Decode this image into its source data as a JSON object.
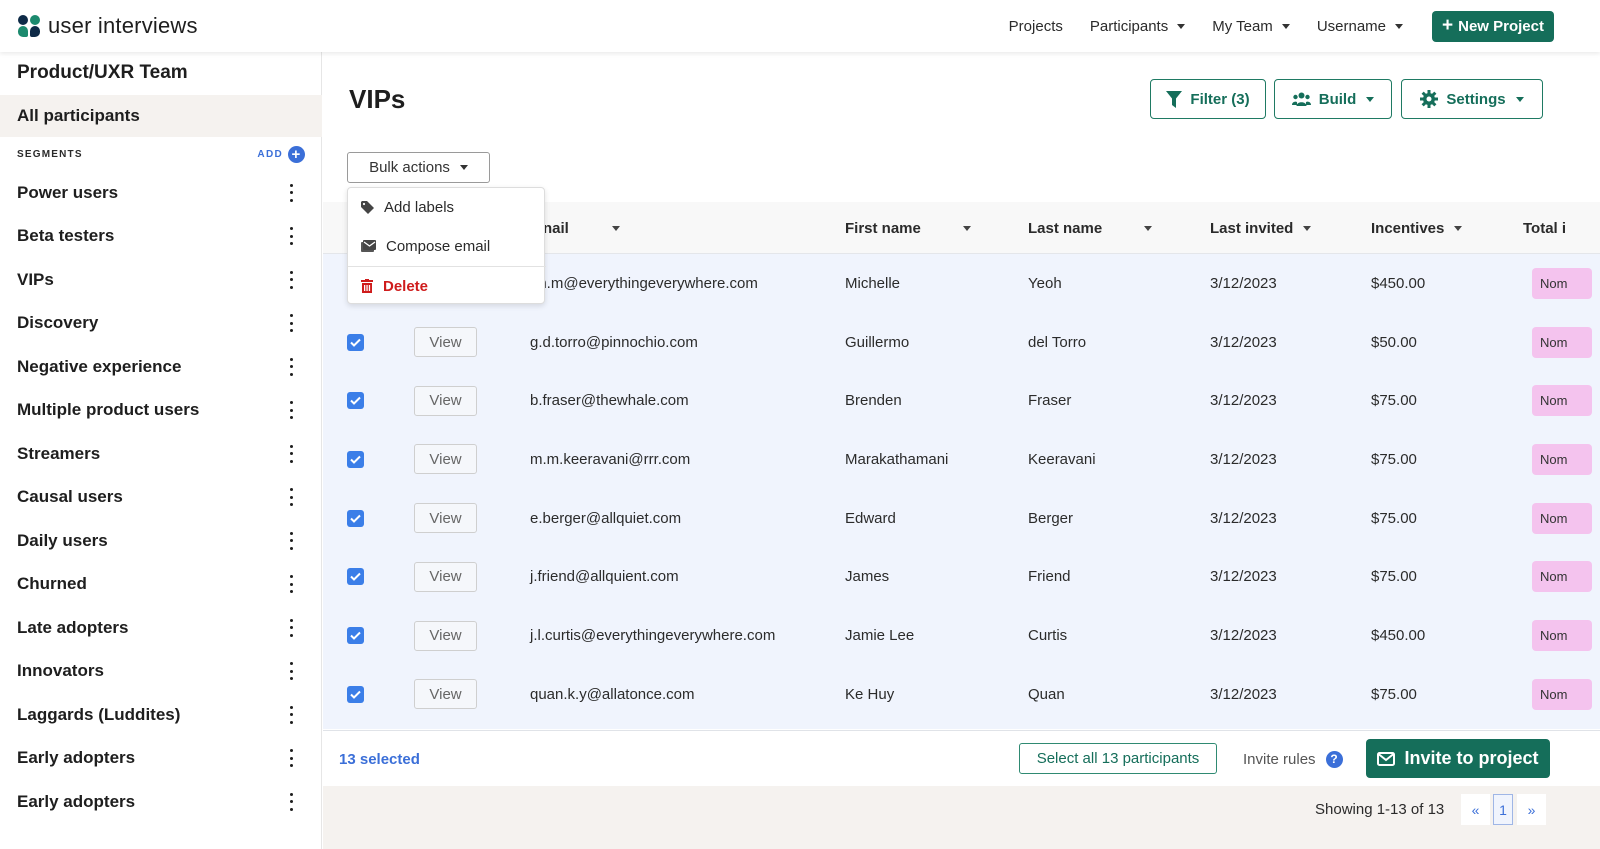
{
  "app": {
    "logo_text": "user interviews"
  },
  "topnav": {
    "items": [
      {
        "label": "Projects",
        "has_caret": false
      },
      {
        "label": "Participants",
        "has_caret": true
      },
      {
        "label": "My Team",
        "has_caret": true
      },
      {
        "label": "Username",
        "has_caret": true
      }
    ],
    "new_project_label": "New Project"
  },
  "sidebar": {
    "team_title": "Product/UXR Team",
    "all_participants_label": "All participants",
    "segments_label": "SEGMENTS",
    "add_label": "ADD",
    "segments": [
      "Power users",
      "Beta testers",
      "VIPs",
      "Discovery",
      "Negative experience",
      "Multiple product users",
      "Streamers",
      "Causal users",
      "Daily users",
      "Churned",
      "Late adopters",
      "Innovators",
      "Laggards (Luddites)",
      "Early adopters",
      "Early adopters"
    ]
  },
  "main": {
    "page_title": "VIPs",
    "toolbar": {
      "filter_label": "Filter (3)",
      "build_label": "Build",
      "settings_label": "Settings"
    },
    "bulk_actions_label": "Bulk actions",
    "bulk_menu": {
      "add_labels": "Add labels",
      "compose_email": "Compose email",
      "delete": "Delete"
    },
    "table": {
      "columns": [
        "nail",
        "First name",
        "Last name",
        "Last invited",
        "Incentives",
        "Total i"
      ],
      "view_label": "View",
      "rows": [
        {
          "email": "oh.m@everythingeverywhere.com",
          "first": "Michelle",
          "last": "Yeoh",
          "invited": "3/12/2023",
          "incentive": "$450.00",
          "tag": "Nom",
          "checked": true
        },
        {
          "email": "g.d.torro@pinnochio.com",
          "first": "Guillermo",
          "last": "del Torro",
          "invited": "3/12/2023",
          "incentive": "$50.00",
          "tag": "Nom",
          "checked": true
        },
        {
          "email": "b.fraser@thewhale.com",
          "first": "Brenden",
          "last": "Fraser",
          "invited": "3/12/2023",
          "incentive": "$75.00",
          "tag": "Nom",
          "checked": true
        },
        {
          "email": "m.m.keeravani@rrr.com",
          "first": "Marakathamani",
          "last": "Keeravani",
          "invited": "3/12/2023",
          "incentive": "$75.00",
          "tag": "Nom",
          "checked": true
        },
        {
          "email": "e.berger@allquiet.com",
          "first": "Edward",
          "last": "Berger",
          "invited": "3/12/2023",
          "incentive": "$75.00",
          "tag": "Nom",
          "checked": true
        },
        {
          "email": "j.friend@allquient.com",
          "first": "James",
          "last": "Friend",
          "invited": "3/12/2023",
          "incentive": "$75.00",
          "tag": "Nom",
          "checked": true
        },
        {
          "email": "j.l.curtis@everythingeverywhere.com",
          "first": "Jamie Lee",
          "last": "Curtis",
          "invited": "3/12/2023",
          "incentive": "$450.00",
          "tag": "Nom",
          "checked": true
        },
        {
          "email": "quan.k.y@allatonce.com",
          "first": "Ke Huy",
          "last": "Quan",
          "invited": "3/12/2023",
          "incentive": "$75.00",
          "tag": "Nom",
          "checked": true
        }
      ]
    },
    "actionbar": {
      "selected_count": "13 selected",
      "select_all_label": "Select all 13 participants",
      "invite_rules_label": "Invite rules",
      "invite_button_label": "Invite to project"
    },
    "pagination": {
      "showing": "Showing 1-13 of 13",
      "prev": "«",
      "current": "1",
      "next": "»"
    }
  },
  "colors": {
    "brand_green": "#156e5a",
    "link_blue": "#3b6fd8",
    "row_selected_bg": "#f0f4fd",
    "tag_pink": "#f4c3ee",
    "danger_red": "#cf1c1c"
  }
}
